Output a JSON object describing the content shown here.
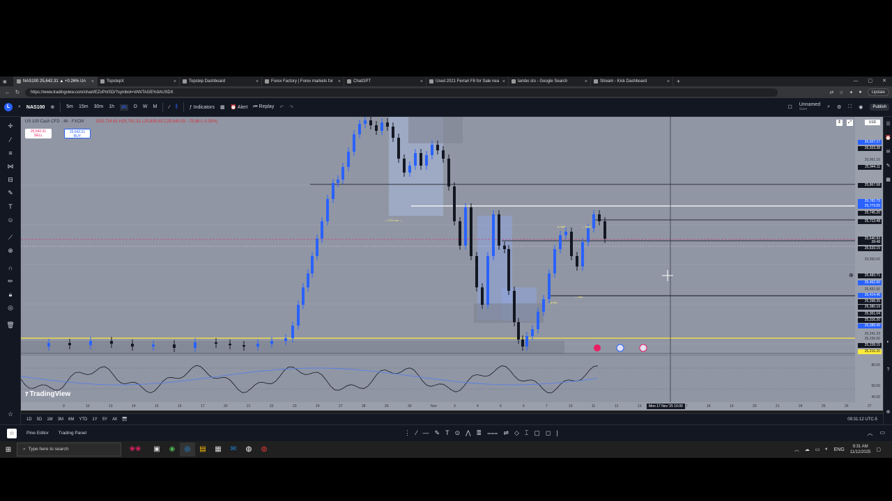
{
  "browser": {
    "tabs": [
      {
        "label": "NAS100 25,642.31 ▲ +0.26% Un",
        "active": true
      },
      {
        "label": "TopstepX",
        "active": false
      },
      {
        "label": "Topstep Dashboard",
        "active": false
      },
      {
        "label": "Forex Factory | Forex markets for",
        "active": false
      },
      {
        "label": "ChatGPT",
        "active": false
      },
      {
        "label": "Used 2021 Ferrari F8 for Sale nea",
        "active": false
      },
      {
        "label": "lambo sto - Google Search",
        "active": false
      },
      {
        "label": "Stream - Kick Dashboard",
        "active": false
      }
    ],
    "url": "https://www.tradingview.com/chart/EZxPnISD/?symbol=VANTAGE%3AUSDX",
    "update_label": "Update"
  },
  "toolbar": {
    "symbol": "NAS100",
    "intervals": [
      "5m",
      "15m",
      "30m",
      "1h",
      "4h",
      "D",
      "W",
      "M"
    ],
    "selected_interval": "4h",
    "indicators_label": "Indicators",
    "alert_label": "Alert",
    "replay_label": "Replay",
    "layout_name": "Unnamed",
    "layout_sub": "Save",
    "publish_label": "Publish"
  },
  "chart": {
    "legend_title": "US 100 Cash CFD · 4h · FXCM",
    "legend_values": "O25,716.81 H25,752.31 L25,639.43 C25,640.93 −75.88 (−0.30%)",
    "sell_price": "25,642.31",
    "sell_label": "SELL",
    "buy_price": "25,643.51",
    "buy_label": "BUY",
    "currency": "USD",
    "annotations": {
      "pdl": "— PDL low —",
      "phigh": "p-high",
      "plow": "p-low",
      "phigh2": "— high",
      "low2": "— low"
    }
  },
  "price_axis": {
    "labels": [
      {
        "text": "26,027.17",
        "style": "blue"
      },
      {
        "text": "26,023.38",
        "style": "dark"
      },
      {
        "text": "25,961.16",
        "style": "plain"
      },
      {
        "text": "25,944.11",
        "style": "dark"
      },
      {
        "text": "25,867.58",
        "style": "dark"
      },
      {
        "text": "25,782.75",
        "style": "blue"
      },
      {
        "text": "25,773.55",
        "style": "blue"
      },
      {
        "text": "25,745.20",
        "style": "dark"
      },
      {
        "text": "25,713.48",
        "style": "dark"
      },
      {
        "text": "25,640.93",
        "style": "dark"
      },
      {
        "text": "28:48",
        "style": "dark"
      },
      {
        "text": "25,633.15",
        "style": "dark"
      },
      {
        "text": "25,550.00",
        "style": "plain"
      },
      {
        "text": "25,483.71",
        "style": "dark"
      },
      {
        "text": "25,462.90",
        "style": "blue"
      },
      {
        "text": "25,431.50",
        "style": "plain"
      },
      {
        "text": "25,414.46",
        "style": "blue"
      },
      {
        "text": "25,398.35",
        "style": "dark"
      },
      {
        "text": "25,380.19",
        "style": "dark"
      },
      {
        "text": "25,361.04",
        "style": "dark"
      },
      {
        "text": "25,316.20",
        "style": "dark"
      },
      {
        "text": "25,289.40",
        "style": "blue"
      },
      {
        "text": "25,241.23",
        "style": "plain"
      },
      {
        "text": "25,235.00",
        "style": "plain"
      },
      {
        "text": "25,228.15",
        "style": "dark"
      },
      {
        "text": "25,216.20",
        "style": "yellow"
      }
    ]
  },
  "osc_axis": [
    "80.00",
    "50.00",
    "40.00"
  ],
  "time_axis": {
    "labels": [
      "9",
      "10",
      "13",
      "14",
      "15",
      "16",
      "17",
      "20",
      "21",
      "22",
      "23",
      "24",
      "27",
      "28",
      "29",
      "30",
      "Nov",
      "3",
      "4",
      "5",
      "6",
      "7",
      "10",
      "11",
      "12",
      "13",
      "14",
      "17",
      "18",
      "19",
      "20",
      "21",
      "24",
      "25",
      "26",
      "27"
    ],
    "cursor_label": "Mon 17 Nov '25  10:00"
  },
  "watermark": "TradingView",
  "range_bar": {
    "ranges": [
      "1D",
      "5D",
      "1M",
      "3M",
      "6M",
      "YTD",
      "1Y",
      "5Y",
      "All"
    ],
    "clock": "09:31:12 UTC-5"
  },
  "panel_bar": {
    "pine_editor": "Pine Editor",
    "trading_panel": "Trading Panel"
  },
  "taskbar": {
    "search_placeholder": "Type here to search",
    "time": "9:31 AM",
    "date": "11/12/2025"
  },
  "colors": {
    "chart_bg": "#9096a4",
    "candle_up": "#2962ff",
    "candle_down": "#131722",
    "accent": "#2962ff",
    "yellow_line": "#ffeb3b"
  }
}
